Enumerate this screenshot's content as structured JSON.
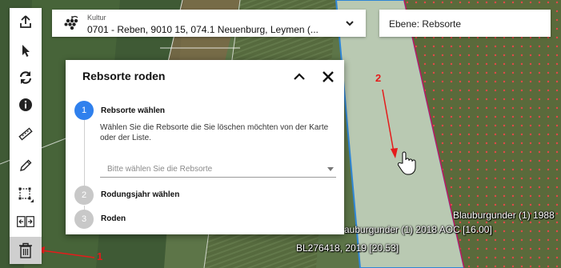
{
  "toolbar": {
    "items": [
      {
        "name": "upload-button",
        "icon": "upload-icon"
      },
      {
        "name": "pointer-button",
        "icon": "cursor-icon"
      },
      {
        "name": "refresh-button",
        "icon": "refresh-icon"
      },
      {
        "name": "info-button",
        "icon": "info-icon"
      },
      {
        "name": "measure-button",
        "icon": "ruler-icon"
      },
      {
        "name": "edit-button",
        "icon": "pencil-icon"
      },
      {
        "name": "transform-button",
        "icon": "transform-icon"
      },
      {
        "name": "move-button",
        "icon": "move-arrows-icon"
      },
      {
        "name": "delete-button",
        "icon": "trash-icon",
        "active": true
      }
    ]
  },
  "kultur": {
    "label": "Kultur",
    "value": "0701 - Reben, 9010 15, 074.1 Neuenburg, Leymen (...",
    "icon": "grape-icon"
  },
  "ebene": {
    "text": "Ebene: Rebsorte"
  },
  "dialog": {
    "title": "Rebsorte roden",
    "steps": [
      {
        "number": "1",
        "title": "Rebsorte wählen",
        "active": true
      },
      {
        "number": "2",
        "title": "Rodungsjahr wählen",
        "active": false
      },
      {
        "number": "3",
        "title": "Roden",
        "active": false
      }
    ],
    "description": "Wählen Sie die Rebsorte die Sie löschen möchten von der Karte oder der Liste.",
    "select_placeholder": "Bitte wählen Sie die Rebsorte"
  },
  "map": {
    "labels": {
      "label1": "Blauburgunder (1) 1988",
      "label2": "auburgunder (1) 2018 AOC [16.00]",
      "label3": "BL276418, 2019 [20.53]"
    }
  },
  "annotations": {
    "a1": "1",
    "a2": "2"
  },
  "colors": {
    "accent": "#2f80ed",
    "annotation": "#e51b1b",
    "step_inactive": "#c8c8c8"
  }
}
